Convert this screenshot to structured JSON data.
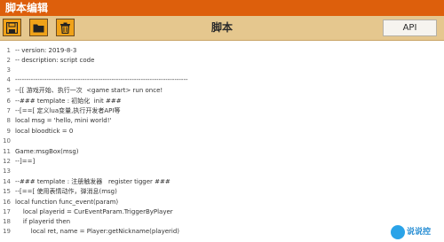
{
  "window": {
    "title": "脚本编辑"
  },
  "toolbar": {
    "buttons": [
      {
        "name": "save",
        "icon": "save-icon"
      },
      {
        "name": "open",
        "icon": "folder-icon"
      },
      {
        "name": "delete",
        "icon": "trash-icon"
      }
    ],
    "doc_name": "脚本",
    "api_label": "API"
  },
  "editor": {
    "lines": [
      {
        "n": "1",
        "text": "-- version: 2019-8-3"
      },
      {
        "n": "2",
        "text": "-- description: script code"
      },
      {
        "n": "3",
        "text": ""
      },
      {
        "n": "4",
        "text": "-----------------------------------------------------------------------------"
      },
      {
        "n": "5",
        "text": "--[[ 游戏开始、执行一次  <game start> run once!"
      },
      {
        "n": "6",
        "text": "--### template : 初始化  init ###"
      },
      {
        "n": "7",
        "text": "--[==[ 定义lua变量,执行开发者API等"
      },
      {
        "n": "8",
        "text": "local msg = 'hello, mini world!'"
      },
      {
        "n": "9",
        "text": "local bloodtick = 0"
      },
      {
        "n": "10",
        "text": ""
      },
      {
        "n": "11",
        "text": "Game:msgBox(msg)"
      },
      {
        "n": "12",
        "text": "--]==]"
      },
      {
        "n": "13",
        "text": ""
      },
      {
        "n": "14",
        "text": "--### template : 注册触发器   register tigger ###"
      },
      {
        "n": "15",
        "text": "--[==[ 使用表情动作，弹消息(msg)"
      },
      {
        "n": "16",
        "text": "local function func_event(param)"
      },
      {
        "n": "17",
        "text": "    local playerid = CurEventParam.TriggerByPlayer"
      },
      {
        "n": "18",
        "text": "    if playerid then"
      },
      {
        "n": "19",
        "text": "        local ret, name = Player:getNickname(playerid)"
      }
    ]
  },
  "watermark": {
    "text": "说说控"
  },
  "colors": {
    "titlebar": "#dd5f0c",
    "toolbar": "#e5c78e",
    "button": "#f0a218"
  }
}
